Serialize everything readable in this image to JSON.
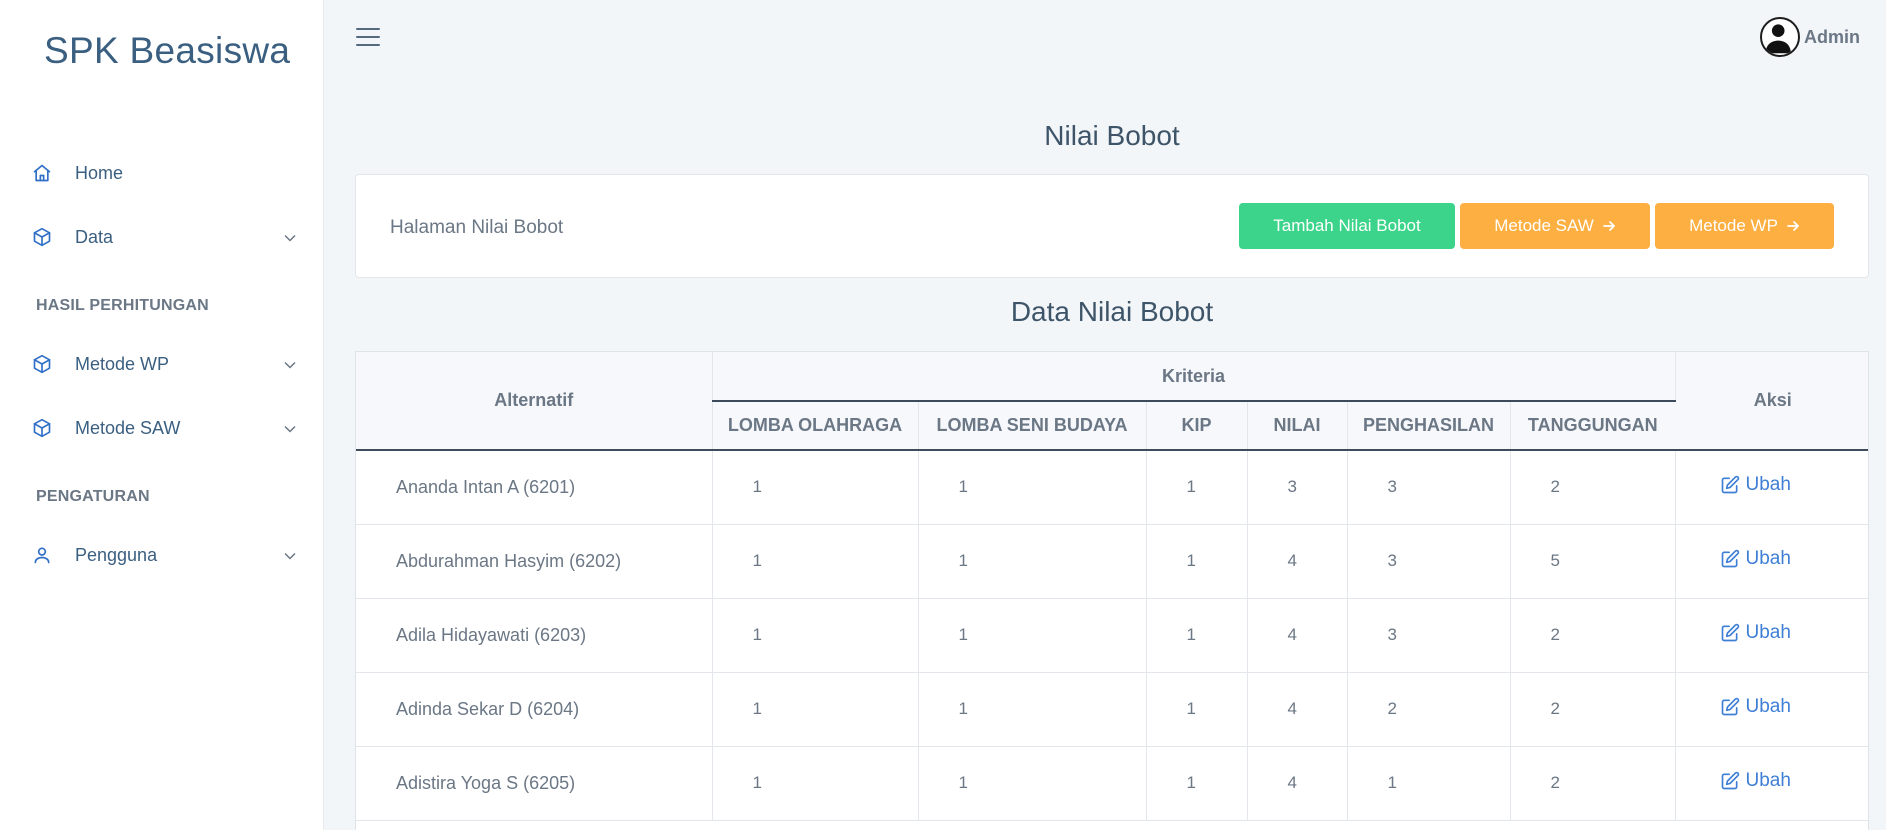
{
  "sidebar": {
    "brand": "SPK Beasiswa",
    "items": [
      {
        "label": "Home",
        "icon": "home-icon"
      },
      {
        "label": "Data",
        "icon": "cube-icon"
      },
      {
        "label": "Metode WP",
        "icon": "cube-icon"
      },
      {
        "label": "Metode SAW",
        "icon": "cube-icon"
      },
      {
        "label": "Pengguna",
        "icon": "user-icon"
      }
    ],
    "sections": {
      "hasil": "HASIL PERHITUNGAN",
      "pengaturan": "PENGATURAN"
    }
  },
  "header": {
    "user_name": "Admin"
  },
  "page": {
    "title": "Nilai Bobot",
    "card_label": "Halaman Nilai Bobot",
    "buttons": {
      "tambah": "Tambah Nilai Bobot",
      "saw": "Metode SAW",
      "wp": "Metode WP"
    },
    "table_title": "Data Nilai Bobot"
  },
  "table": {
    "headers": {
      "alternatif": "Alternatif",
      "kriteria": "Kriteria",
      "aksi": "Aksi",
      "criteria": [
        "LOMBA OLAHRAGA",
        "LOMBA SENI BUDAYA",
        "KIP",
        "NILAI",
        "PENGHASILAN",
        "TANGGUNGAN"
      ]
    },
    "action_label": "Ubah",
    "rows": [
      {
        "name": "Ananda Intan A (6201)",
        "values": [
          "1",
          "1",
          "1",
          "3",
          "3",
          "2"
        ]
      },
      {
        "name": "Abdurahman Hasyim (6202)",
        "values": [
          "1",
          "1",
          "1",
          "4",
          "3",
          "5"
        ]
      },
      {
        "name": "Adila Hidayawati (6203)",
        "values": [
          "1",
          "1",
          "1",
          "4",
          "3",
          "2"
        ]
      },
      {
        "name": "Adinda Sekar D (6204)",
        "values": [
          "1",
          "1",
          "1",
          "4",
          "2",
          "2"
        ]
      },
      {
        "name": "Adistira Yoga S (6205)",
        "values": [
          "1",
          "1",
          "1",
          "4",
          "1",
          "2"
        ]
      }
    ]
  },
  "colors": {
    "accent": "#3e7fd6",
    "green_button": "#3cd38a",
    "orange_button": "#fdaf41",
    "brand_text": "#3b5f80"
  }
}
